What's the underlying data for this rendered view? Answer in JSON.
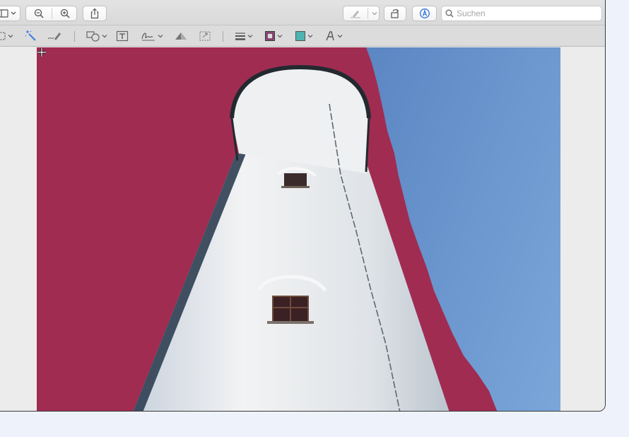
{
  "toolbar": {
    "search_placeholder": "Suchen",
    "icons": [
      "sidebar-icon",
      "zoom-out-icon",
      "zoom-in-icon",
      "share-icon",
      "highlight-pen-icon",
      "rotate-icon",
      "markup-icon",
      "search-icon"
    ]
  },
  "markup_toolbar": {
    "tools": [
      "selection-tool-icon",
      "instant-alpha-icon",
      "sketch-icon",
      "shapes-icon",
      "text-icon",
      "sign-icon",
      "adjust-color-icon",
      "adjust-size-icon",
      "shape-style-icon",
      "border-color-icon",
      "fill-color-icon",
      "text-style-icon"
    ],
    "border_color": "#7a2f63",
    "fill_color": "#4fb3b0"
  },
  "document": {
    "mask_color": "#a02c52",
    "sky_color": "#5a82c0",
    "tower_color": "#e4e7ea"
  }
}
